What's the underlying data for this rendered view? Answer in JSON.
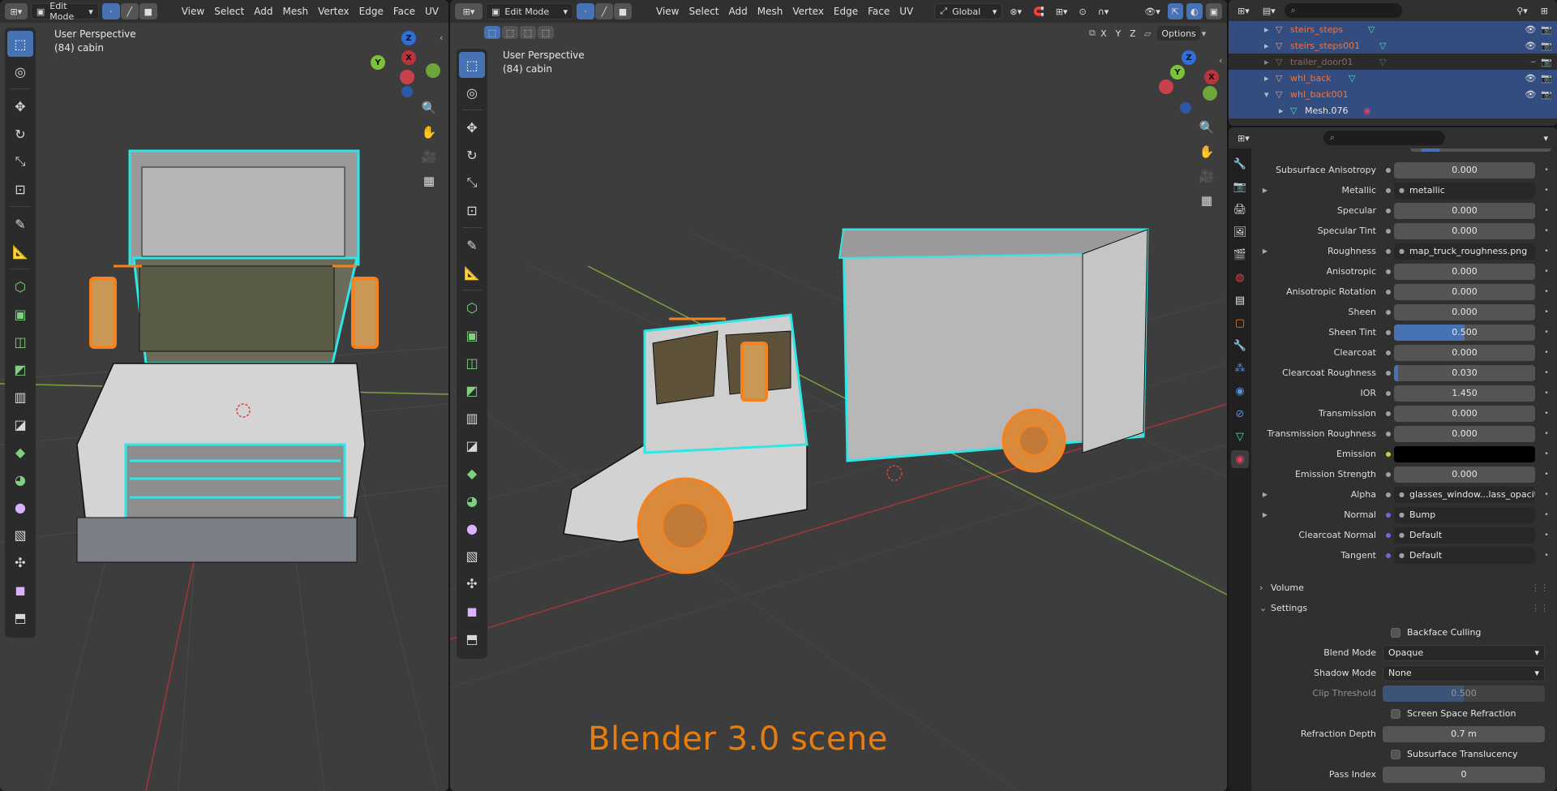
{
  "left_view": {
    "mode": "Edit Mode",
    "menus": [
      "View",
      "Select",
      "Add",
      "Mesh",
      "Vertex",
      "Edge",
      "Face",
      "UV"
    ],
    "perspective": "User Perspective",
    "object": "(84) cabin",
    "gizmo": {
      "z": "Z",
      "y": "Y",
      "x": "X"
    }
  },
  "right_view": {
    "mode": "Edit Mode",
    "menus": [
      "View",
      "Select",
      "Add",
      "Mesh",
      "Vertex",
      "Edge",
      "Face",
      "UV"
    ],
    "orientation": "Global",
    "options": "Options",
    "axes": [
      "X",
      "Y",
      "Z"
    ],
    "perspective": "User Perspective",
    "object": "(84) cabin",
    "gizmo": {
      "z": "Z",
      "y": "Y",
      "x": "X"
    }
  },
  "outliner": {
    "rows": [
      {
        "name": "steirs_steps",
        "color": "#f0753c",
        "selected": true
      },
      {
        "name": "steirs_steps001",
        "color": "#f0753c",
        "selected": true
      },
      {
        "name": "trailer_door01",
        "color": "#8a6a58",
        "selected": false
      },
      {
        "name": "whl_back",
        "color": "#f0753c",
        "selected": true
      },
      {
        "name": "whl_back001",
        "color": "#f0753c",
        "selected": true
      },
      {
        "name": "Mesh.076",
        "color": "#e6e6e6",
        "selected": true
      }
    ]
  },
  "properties": {
    "rows": [
      {
        "label": "Subsurface Anisotropy",
        "value": "0.000",
        "kind": "num"
      },
      {
        "label": "Metallic",
        "value": "metallic",
        "kind": "link",
        "expand": true
      },
      {
        "label": "Specular",
        "value": "0.000",
        "kind": "num"
      },
      {
        "label": "Specular Tint",
        "value": "0.000",
        "kind": "num"
      },
      {
        "label": "Roughness",
        "value": "map_truck_roughness.png",
        "kind": "link",
        "expand": true
      },
      {
        "label": "Anisotropic",
        "value": "0.000",
        "kind": "num"
      },
      {
        "label": "Anisotropic Rotation",
        "value": "0.000",
        "kind": "num"
      },
      {
        "label": "Sheen",
        "value": "0.000",
        "kind": "num"
      },
      {
        "label": "Sheen Tint",
        "value": "0.500",
        "kind": "slider",
        "fill": 0.5
      },
      {
        "label": "Clearcoat",
        "value": "0.000",
        "kind": "num"
      },
      {
        "label": "Clearcoat Roughness",
        "value": "0.030",
        "kind": "slider",
        "fill": 0.03
      },
      {
        "label": "IOR",
        "value": "1.450",
        "kind": "num"
      },
      {
        "label": "Transmission",
        "value": "0.000",
        "kind": "num"
      },
      {
        "label": "Transmission Roughness",
        "value": "0.000",
        "kind": "num"
      },
      {
        "label": "Emission",
        "value": "",
        "kind": "color",
        "color": "#000000"
      },
      {
        "label": "Emission Strength",
        "value": "0.000",
        "kind": "num"
      },
      {
        "label": "Alpha",
        "value": "glasses_window...lass_opacity.png",
        "kind": "link",
        "expand": true
      },
      {
        "label": "Normal",
        "value": "Bump",
        "kind": "link",
        "expand": true
      },
      {
        "label": "Clearcoat Normal",
        "value": "Default",
        "kind": "link"
      },
      {
        "label": "Tangent",
        "value": "Default",
        "kind": "link"
      }
    ],
    "volume_label": "Volume",
    "settings_label": "Settings",
    "backface_culling": "Backface Culling",
    "blend_mode_label": "Blend Mode",
    "blend_mode": "Opaque",
    "shadow_mode_label": "Shadow Mode",
    "shadow_mode": "None",
    "clip_threshold_label": "Clip Threshold",
    "clip_threshold": "0.500",
    "ssr_label": "Screen Space Refraction",
    "refraction_depth_label": "Refraction Depth",
    "refraction_depth": "0.7 m",
    "sss_label": "Subsurface Translucency",
    "pass_index_label": "Pass Index",
    "pass_index": "0"
  },
  "caption": "Blender 3.0 scene",
  "colors": {
    "accent": "#4772b3",
    "selected_orange": "#f5821f",
    "wire_cyan": "#2ee6e6"
  }
}
